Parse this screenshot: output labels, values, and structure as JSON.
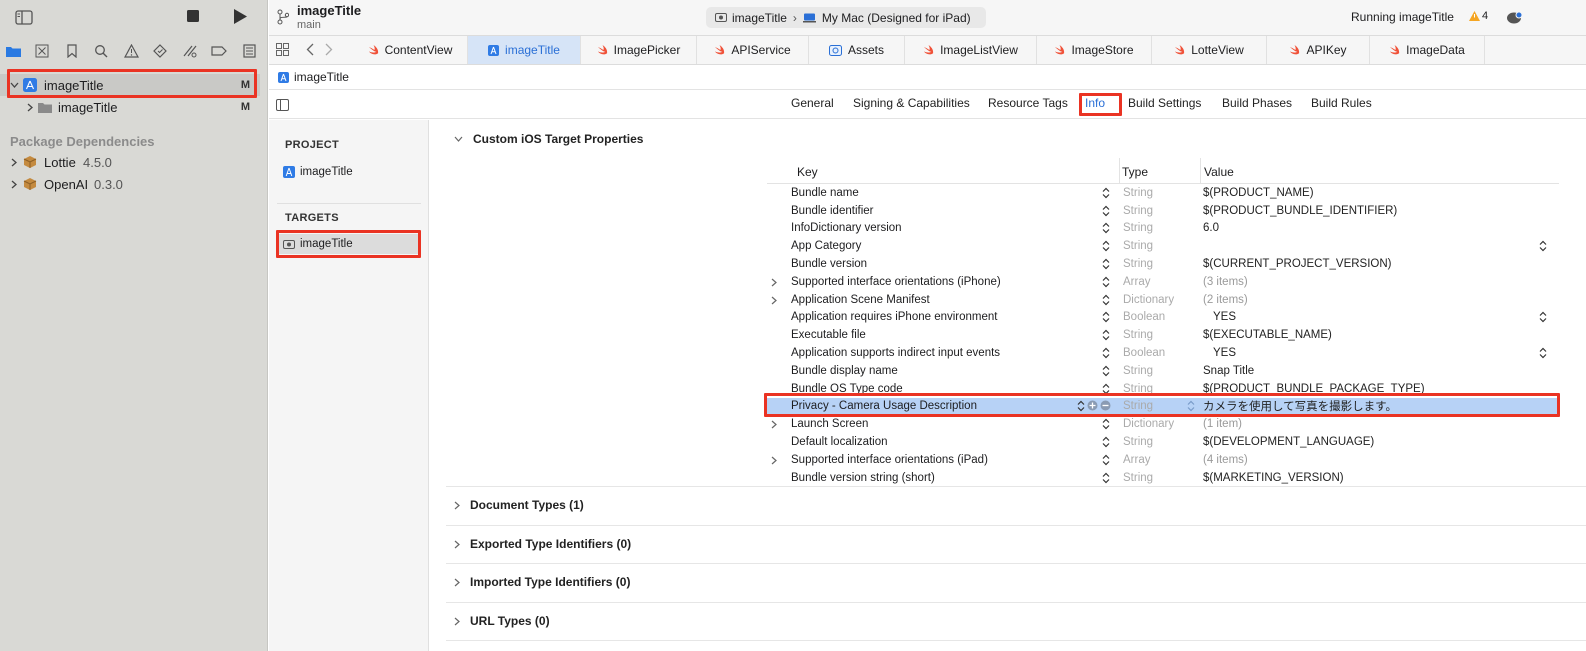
{
  "window": {
    "project_name": "imageTitle",
    "branch": "main"
  },
  "toolbar": {
    "scheme": "imageTitle",
    "destination": "My Mac (Designed for iPad)",
    "status": "Running imageTitle",
    "warning_count": "4"
  },
  "navigator": {
    "project": {
      "label": "imageTitle",
      "badge": "M"
    },
    "folder": {
      "label": "imageTitle",
      "badge": "M"
    },
    "package_header": "Package Dependencies",
    "packages": [
      {
        "name": "Lottie",
        "version": "4.5.0"
      },
      {
        "name": "OpenAI",
        "version": "0.3.0"
      }
    ]
  },
  "tabs": [
    {
      "label": "ContentView",
      "icon": "swift-icon"
    },
    {
      "label": "imageTitle",
      "icon": "project-icon"
    },
    {
      "label": "ImagePicker",
      "icon": "swift-icon"
    },
    {
      "label": "APIService",
      "icon": "swift-icon"
    },
    {
      "label": "Assets",
      "icon": "assets-icon"
    },
    {
      "label": "ImageListView",
      "icon": "swift-icon"
    },
    {
      "label": "ImageStore",
      "icon": "swift-icon"
    },
    {
      "label": "LotteView",
      "icon": "swift-icon"
    },
    {
      "label": "APIKey",
      "icon": "swift-icon"
    },
    {
      "label": "ImageData",
      "icon": "swift-icon"
    }
  ],
  "jumpbar": {
    "label": "imageTitle"
  },
  "segments": [
    "General",
    "Signing & Capabilities",
    "Resource Tags",
    "Info",
    "Build Settings",
    "Build Phases",
    "Build Rules"
  ],
  "targets_pane": {
    "project_header": "PROJECT",
    "project": "imageTitle",
    "targets_header": "TARGETS",
    "target": "imageTitle"
  },
  "info": {
    "section_title": "Custom iOS Target Properties",
    "columns": {
      "key": "Key",
      "type": "Type",
      "value": "Value"
    },
    "rows": [
      {
        "key": "Bundle name",
        "type": "String",
        "value": "$(PRODUCT_NAME)"
      },
      {
        "key": "Bundle identifier",
        "type": "String",
        "value": "$(PRODUCT_BUNDLE_IDENTIFIER)"
      },
      {
        "key": "InfoDictionary version",
        "type": "String",
        "value": "6.0"
      },
      {
        "key": "App Category",
        "type": "String",
        "value": ""
      },
      {
        "key": "Bundle version",
        "type": "String",
        "value": "$(CURRENT_PROJECT_VERSION)"
      },
      {
        "key": "Supported interface orientations (iPhone)",
        "type": "Array",
        "value": "(3 items)"
      },
      {
        "key": "Application Scene Manifest",
        "type": "Dictionary",
        "value": "(2 items)"
      },
      {
        "key": "Application requires iPhone environment",
        "type": "Boolean",
        "value": "YES"
      },
      {
        "key": "Executable file",
        "type": "String",
        "value": "$(EXECUTABLE_NAME)"
      },
      {
        "key": "Application supports indirect input events",
        "type": "Boolean",
        "value": "YES"
      },
      {
        "key": "Bundle display name",
        "type": "String",
        "value": "Snap Title"
      },
      {
        "key": "Bundle OS Type code",
        "type": "String",
        "value": "$(PRODUCT_BUNDLE_PACKAGE_TYPE)"
      },
      {
        "key": "Privacy - Camera Usage Description",
        "type": "String",
        "value": "カメラを使用して写真を撮影します。"
      },
      {
        "key": "Launch Screen",
        "type": "Dictionary",
        "value": "(1 item)"
      },
      {
        "key": "Default localization",
        "type": "String",
        "value": "$(DEVELOPMENT_LANGUAGE)"
      },
      {
        "key": "Supported interface orientations (iPad)",
        "type": "Array",
        "value": "(4 items)"
      },
      {
        "key": "Bundle version string (short)",
        "type": "String",
        "value": "$(MARKETING_VERSION)"
      }
    ],
    "groups": [
      "Document Types (1)",
      "Exported Type Identifiers (0)",
      "Imported Type Identifiers (0)",
      "URL Types (0)"
    ]
  },
  "colors": {
    "accent": "#2a6fd6",
    "highlight": "#ea3323",
    "selected_row": "#b7d2f6"
  }
}
